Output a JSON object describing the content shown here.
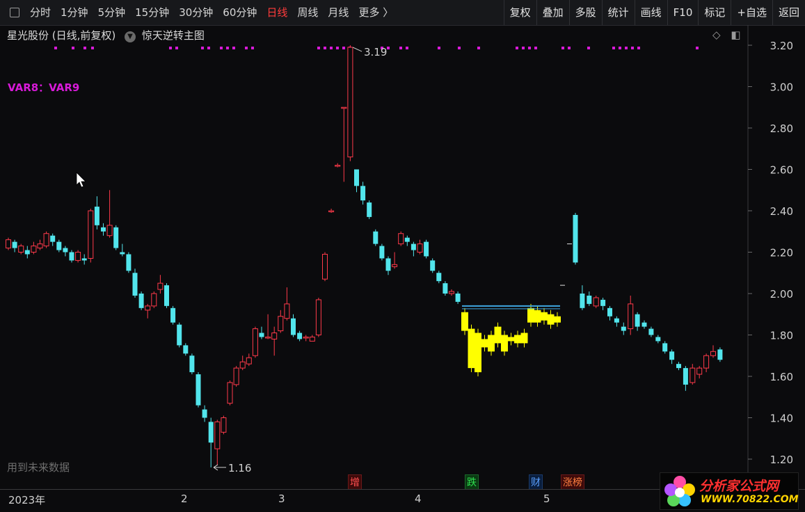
{
  "toolbar": {
    "periods": [
      "分时",
      "1分钟",
      "5分钟",
      "15分钟",
      "30分钟",
      "60分钟",
      "日线",
      "周线",
      "月线",
      "更多 〉"
    ],
    "active_period": "日线",
    "actions": [
      "复权",
      "叠加",
      "多股",
      "统计",
      "画线",
      "F10",
      "标记",
      "+自选",
      "返回"
    ]
  },
  "chart_header": {
    "title": "星光股份 (日线,前复权)",
    "template": "惊天逆转主图"
  },
  "indicator_label": "VAR8：VAR9",
  "footer_note": "用到未来数据",
  "x_axis_labels": [
    {
      "text": "2023年"
    },
    {
      "text": "2"
    },
    {
      "text": "3"
    },
    {
      "text": "4"
    },
    {
      "text": "5"
    }
  ],
  "event_markers": [
    {
      "text": "增",
      "kind": "zeng"
    },
    {
      "text": "跌",
      "kind": "die"
    },
    {
      "text": "财",
      "kind": "cai"
    },
    {
      "text": "涨榜",
      "kind": "zb"
    }
  ],
  "watermark": {
    "line1": "分析家公式网",
    "line2": "WWW.70822.COM"
  },
  "chart_data": {
    "type": "candlestick",
    "y_ticks": [
      "3.20",
      "3.00",
      "2.80",
      "2.60",
      "2.40",
      "2.20",
      "2.00",
      "1.80",
      "1.60",
      "1.40",
      "1.20"
    ],
    "ylim": [
      1.14,
      3.25
    ],
    "annotations": [
      {
        "text": "3.19",
        "kind": "high",
        "value": 3.19
      },
      {
        "text": "1.16",
        "kind": "low",
        "value": 1.16
      }
    ],
    "colors": {
      "up": "#ff3a4a",
      "down": "#52e5ec",
      "special": "#ffff00",
      "dot": "#d81ad8",
      "hline": "#3fa7e0",
      "grid": "#2a2a2a"
    },
    "hline_level": 1.94,
    "candles": [
      [
        2.22,
        2.26,
        2.27,
        2.21
      ],
      [
        2.25,
        2.22,
        2.26,
        2.2
      ],
      [
        2.2,
        2.23,
        2.24,
        2.19
      ],
      [
        2.21,
        2.19,
        2.23,
        2.17
      ],
      [
        2.2,
        2.23,
        2.25,
        2.19
      ],
      [
        2.22,
        2.24,
        2.26,
        2.21
      ],
      [
        2.23,
        2.29,
        2.3,
        2.22
      ],
      [
        2.28,
        2.25,
        2.29,
        2.23
      ],
      [
        2.25,
        2.21,
        2.26,
        2.2
      ],
      [
        2.22,
        2.2,
        2.23,
        2.18
      ],
      [
        2.2,
        2.16,
        2.21,
        2.15
      ],
      [
        2.16,
        2.2,
        2.21,
        2.15
      ],
      [
        2.17,
        2.16,
        2.19,
        2.14
      ],
      [
        2.17,
        2.4,
        2.41,
        2.15
      ],
      [
        2.42,
        2.33,
        2.47,
        2.31
      ],
      [
        2.32,
        2.3,
        2.34,
        2.28
      ],
      [
        2.28,
        2.33,
        2.5,
        2.27
      ],
      [
        2.32,
        2.22,
        2.33,
        2.21
      ],
      [
        2.2,
        2.19,
        2.24,
        2.18
      ],
      [
        2.19,
        2.11,
        2.2,
        2.1
      ],
      [
        2.1,
        1.99,
        2.12,
        1.98
      ],
      [
        2.0,
        1.93,
        2.01,
        1.92
      ],
      [
        1.92,
        1.94,
        1.95,
        1.88
      ],
      [
        1.94,
        2.0,
        2.01,
        1.93
      ],
      [
        2.02,
        2.05,
        2.09,
        2.0
      ],
      [
        2.04,
        1.94,
        2.05,
        1.93
      ],
      [
        1.93,
        1.86,
        1.94,
        1.85
      ],
      [
        1.85,
        1.75,
        1.86,
        1.74
      ],
      [
        1.75,
        1.71,
        1.76,
        1.7
      ],
      [
        1.7,
        1.62,
        1.71,
        1.61
      ],
      [
        1.61,
        1.46,
        1.62,
        1.45
      ],
      [
        1.44,
        1.4,
        1.46,
        1.38
      ],
      [
        1.38,
        1.28,
        1.4,
        1.16
      ],
      [
        1.25,
        1.38,
        1.39,
        1.17
      ],
      [
        1.33,
        1.4,
        1.41,
        1.32
      ],
      [
        1.47,
        1.57,
        1.58,
        1.46
      ],
      [
        1.56,
        1.64,
        1.65,
        1.55
      ],
      [
        1.64,
        1.67,
        1.7,
        1.63
      ],
      [
        1.66,
        1.69,
        1.71,
        1.65
      ],
      [
        1.7,
        1.83,
        1.84,
        1.69
      ],
      [
        1.81,
        1.79,
        1.84,
        1.78
      ],
      [
        1.79,
        1.79,
        1.9,
        1.78
      ],
      [
        1.78,
        1.81,
        1.84,
        1.7
      ],
      [
        1.82,
        1.89,
        1.92,
        1.81
      ],
      [
        1.88,
        1.95,
        2.03,
        1.87
      ],
      [
        1.88,
        1.8,
        1.9,
        1.79
      ],
      [
        1.81,
        1.78,
        1.82,
        1.77
      ],
      [
        1.79,
        1.79,
        1.8,
        1.77
      ],
      [
        1.77,
        1.79,
        1.8,
        1.77
      ],
      [
        1.8,
        1.97,
        1.98,
        1.79
      ],
      [
        2.07,
        2.19,
        2.2,
        2.06
      ],
      [
        2.4,
        2.4,
        2.41,
        2.39
      ],
      [
        2.62,
        2.62,
        2.63,
        2.61
      ],
      [
        2.9,
        2.9,
        2.9,
        2.54
      ],
      [
        2.66,
        3.19,
        3.2,
        2.64
      ],
      [
        2.6,
        2.52,
        2.6,
        2.49
      ],
      [
        2.52,
        2.45,
        2.54,
        2.43
      ],
      [
        2.44,
        2.37,
        2.45,
        2.36
      ],
      [
        2.3,
        2.24,
        2.31,
        2.23
      ],
      [
        2.23,
        2.17,
        2.24,
        2.16
      ],
      [
        2.17,
        2.11,
        2.18,
        2.09
      ],
      [
        2.13,
        2.14,
        2.2,
        2.12
      ],
      [
        2.24,
        2.29,
        2.3,
        2.23
      ],
      [
        2.27,
        2.25,
        2.28,
        2.23
      ],
      [
        2.24,
        2.21,
        2.25,
        2.18
      ],
      [
        2.2,
        2.24,
        2.26,
        2.19
      ],
      [
        2.25,
        2.18,
        2.26,
        2.17
      ],
      [
        2.16,
        2.11,
        2.17,
        2.1
      ],
      [
        2.1,
        2.06,
        2.11,
        2.05
      ],
      [
        2.05,
        2.0,
        2.06,
        1.99
      ],
      [
        2.0,
        2.01,
        2.02,
        1.99
      ],
      [
        2.0,
        1.96,
        2.01,
        1.95
      ]
    ],
    "yellow_blocks": [
      [
        1.91,
        1.82
      ],
      [
        1.83,
        1.64
      ],
      [
        1.81,
        1.62
      ],
      [
        1.78,
        1.74
      ],
      [
        1.8,
        1.72
      ],
      [
        1.84,
        1.76
      ],
      [
        1.8,
        1.72
      ],
      [
        1.79,
        1.77
      ],
      [
        1.8,
        1.76
      ],
      [
        1.81,
        1.76
      ],
      [
        1.93,
        1.86
      ],
      [
        1.92,
        1.86
      ],
      [
        1.91,
        1.87
      ],
      [
        1.9,
        1.85
      ],
      [
        1.89,
        1.86
      ]
    ],
    "gap_marks": [
      2.24,
      2.04
    ],
    "tail_candles": [
      [
        2.38,
        2.15,
        2.39,
        2.14
      ],
      [
        2.0,
        1.93,
        2.04,
        1.92
      ],
      [
        1.99,
        1.95,
        2.01,
        1.94
      ],
      [
        1.94,
        1.98,
        1.99,
        1.93
      ],
      [
        1.97,
        1.94,
        1.98,
        1.92
      ],
      [
        1.93,
        1.89,
        1.94,
        1.87
      ],
      [
        1.88,
        1.86,
        1.89,
        1.84
      ],
      [
        1.84,
        1.82,
        1.86,
        1.8
      ],
      [
        1.83,
        1.95,
        1.99,
        1.8
      ],
      [
        1.9,
        1.84,
        1.91,
        1.82
      ],
      [
        1.86,
        1.84,
        1.87,
        1.83
      ],
      [
        1.83,
        1.8,
        1.84,
        1.79
      ],
      [
        1.79,
        1.77,
        1.8,
        1.76
      ],
      [
        1.76,
        1.72,
        1.77,
        1.71
      ],
      [
        1.72,
        1.68,
        1.73,
        1.66
      ],
      [
        1.66,
        1.64,
        1.67,
        1.63
      ],
      [
        1.64,
        1.56,
        1.65,
        1.53
      ],
      [
        1.57,
        1.64,
        1.66,
        1.56
      ],
      [
        1.61,
        1.64,
        1.65,
        1.59
      ],
      [
        1.64,
        1.7,
        1.71,
        1.62
      ],
      [
        1.7,
        1.72,
        1.75,
        1.69
      ],
      [
        1.73,
        1.68,
        1.74,
        1.67
      ]
    ]
  }
}
